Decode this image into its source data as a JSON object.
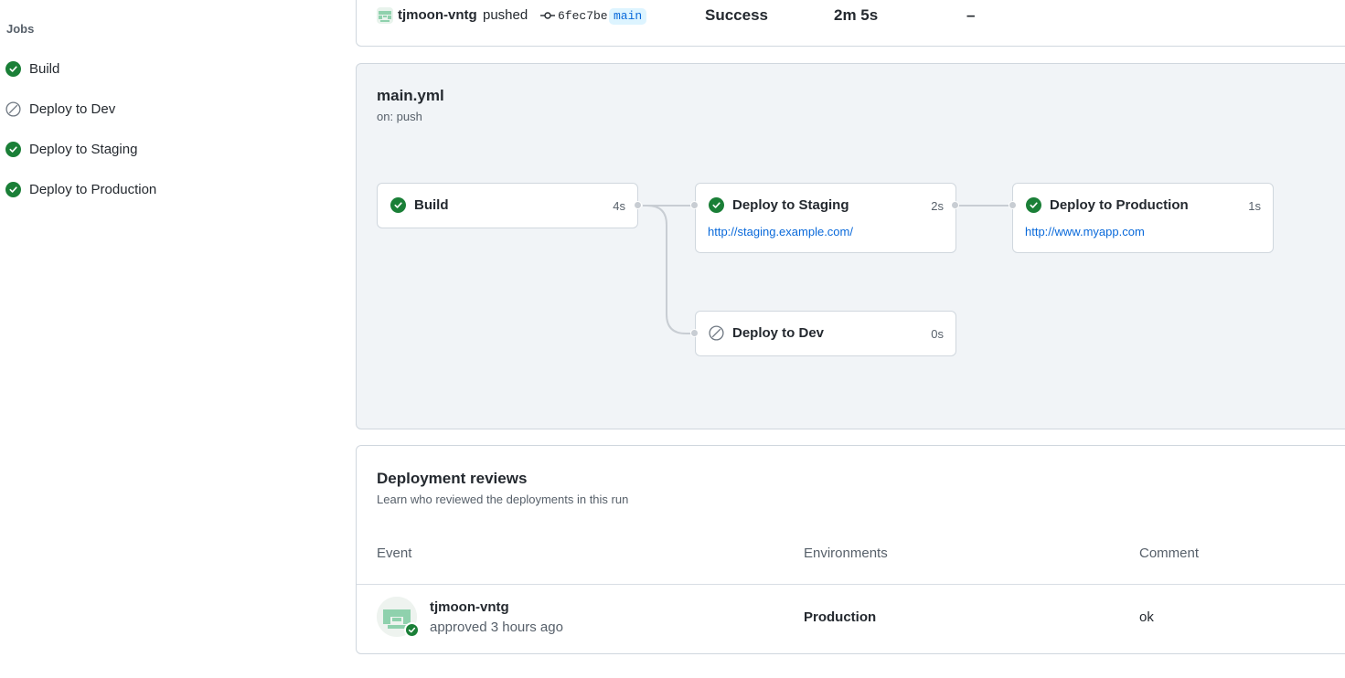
{
  "colors": {
    "success": "#1a7f37",
    "link": "#0969da",
    "muted": "#57606a",
    "panel_bg": "#f1f4f7",
    "border": "#d0d7de"
  },
  "sidebar": {
    "heading": "Jobs",
    "items": [
      {
        "label": "Build",
        "status": "success",
        "icon": "check-circle-icon"
      },
      {
        "label": "Deploy to Dev",
        "status": "skipped",
        "icon": "skip-icon"
      },
      {
        "label": "Deploy to Staging",
        "status": "success",
        "icon": "check-circle-icon"
      },
      {
        "label": "Deploy to Production",
        "status": "success",
        "icon": "check-circle-icon"
      }
    ]
  },
  "summary": {
    "actor": "tjmoon-vntg",
    "verb": "pushed",
    "commit": "6fec7be",
    "branch": "main",
    "status": "Success",
    "duration": "2m 5s",
    "artifacts": "–"
  },
  "workflow": {
    "name": "main.yml",
    "trigger": "on: push",
    "jobs": [
      {
        "name": "Build",
        "time": "4s",
        "status": "success"
      },
      {
        "name": "Deploy to Staging",
        "time": "2s",
        "status": "success",
        "url": "http://staging.example.com/"
      },
      {
        "name": "Deploy to Production",
        "time": "1s",
        "status": "success",
        "url": "http://www.myapp.com"
      },
      {
        "name": "Deploy to Dev",
        "time": "0s",
        "status": "skipped"
      }
    ]
  },
  "reviews": {
    "title": "Deployment reviews",
    "subtitle": "Learn who reviewed the deployments in this run",
    "columns": [
      "Event",
      "Environments",
      "Comment"
    ],
    "rows": [
      {
        "user": "tjmoon-vntg",
        "action": "approved 3 hours ago",
        "environment": "Production",
        "comment": "ok"
      }
    ]
  }
}
